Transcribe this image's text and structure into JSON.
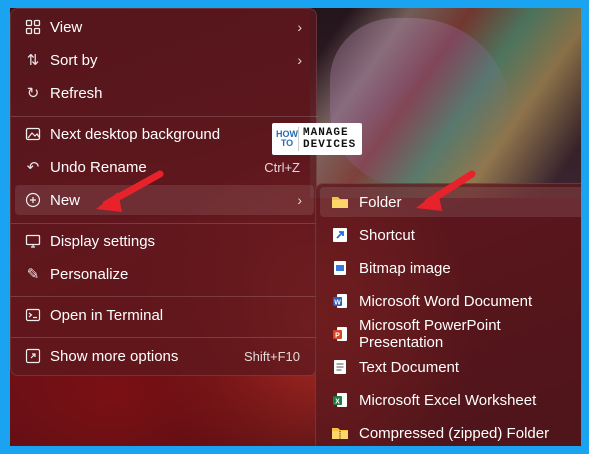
{
  "context_menu": {
    "items": [
      {
        "label": "View",
        "icon": "grid-icon",
        "has_submenu": true
      },
      {
        "label": "Sort by",
        "icon": "sort-icon",
        "has_submenu": true
      },
      {
        "label": "Refresh",
        "icon": "refresh-icon"
      },
      {
        "label": "Next desktop background",
        "icon": "image-icon"
      },
      {
        "label": "Undo Rename",
        "icon": "undo-icon",
        "shortcut": "Ctrl+Z"
      },
      {
        "label": "New",
        "icon": "plus-circle-icon",
        "has_submenu": true
      },
      {
        "label": "Display settings",
        "icon": "display-icon"
      },
      {
        "label": "Personalize",
        "icon": "brush-icon"
      },
      {
        "label": "Open in Terminal",
        "icon": "terminal-icon"
      },
      {
        "label": "Show more options",
        "icon": "expand-icon",
        "shortcut": "Shift+F10"
      }
    ]
  },
  "new_submenu": {
    "items": [
      {
        "label": "Folder",
        "icon": "folder-icon"
      },
      {
        "label": "Shortcut",
        "icon": "shortcut-icon"
      },
      {
        "label": "Bitmap image",
        "icon": "bitmap-icon"
      },
      {
        "label": "Microsoft Word Document",
        "icon": "word-icon"
      },
      {
        "label": "Microsoft PowerPoint Presentation",
        "icon": "powerpoint-icon"
      },
      {
        "label": "Text Document",
        "icon": "text-document-icon"
      },
      {
        "label": "Microsoft Excel Worksheet",
        "icon": "excel-icon"
      },
      {
        "label": "Compressed (zipped) Folder",
        "icon": "zip-folder-icon"
      }
    ]
  },
  "logo": {
    "top": "HOW TO",
    "bottom": "MANAGE DEVICES"
  },
  "colors": {
    "accent_arrow": "#e8222a",
    "frame": "#1aa3f0",
    "menu_bg": "#5c181e"
  }
}
